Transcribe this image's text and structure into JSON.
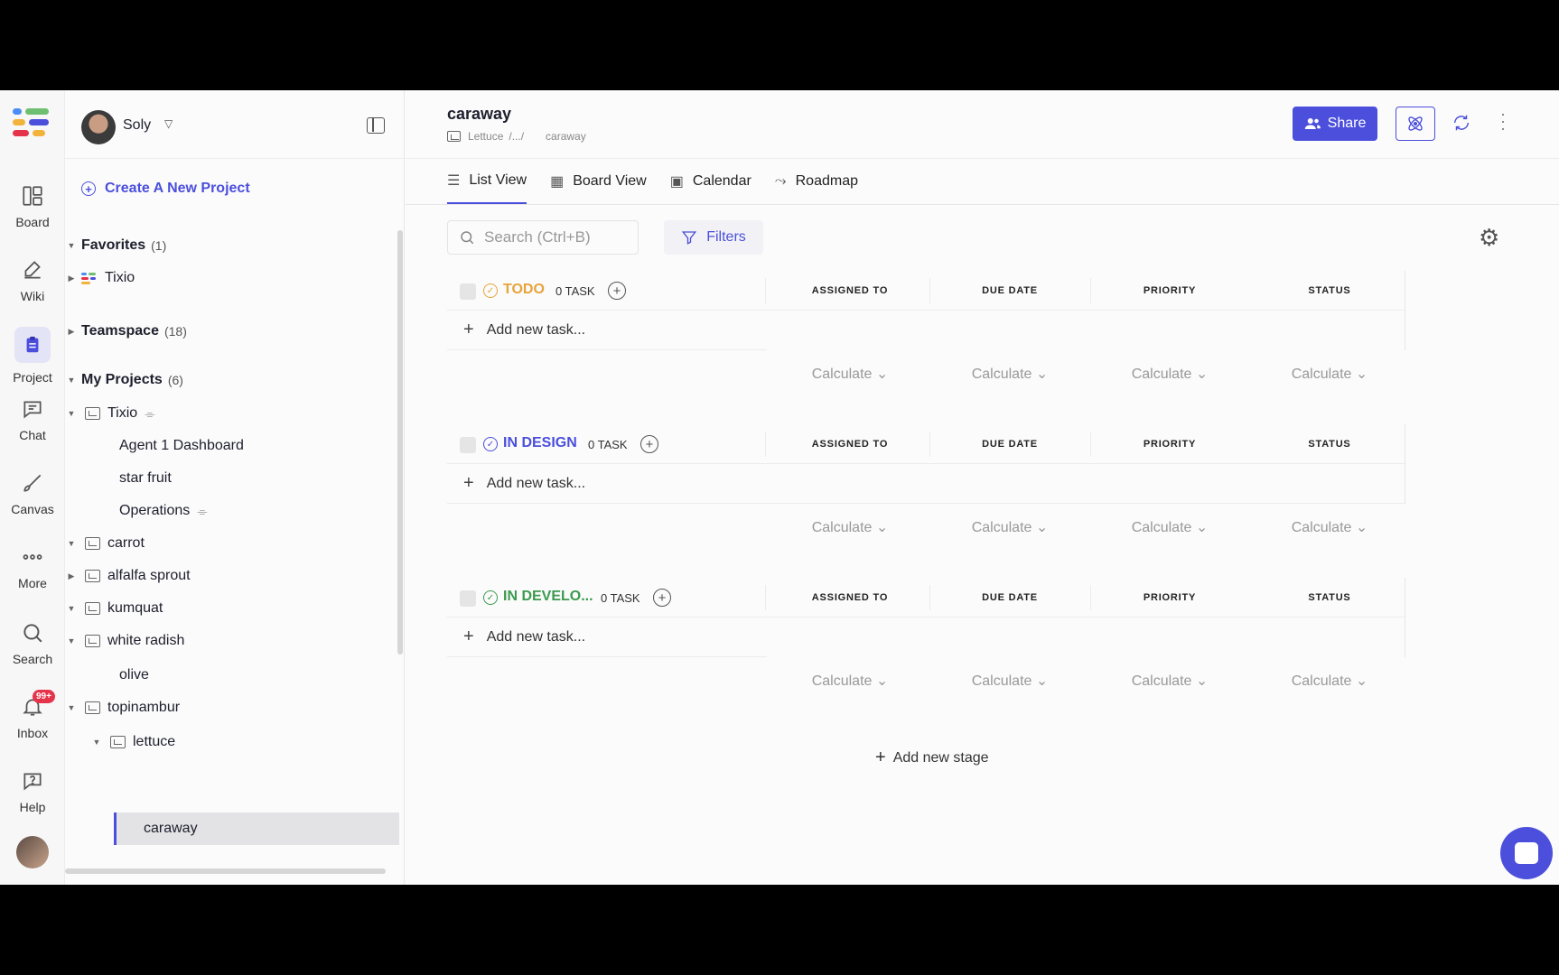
{
  "rail": {
    "items": [
      {
        "label": "Board",
        "icon": "board-icon"
      },
      {
        "label": "Wiki",
        "icon": "wiki-icon"
      },
      {
        "label": "Project",
        "icon": "project-icon"
      },
      {
        "label": "Chat",
        "icon": "chat-icon"
      },
      {
        "label": "Canvas",
        "icon": "canvas-icon"
      },
      {
        "label": "More",
        "icon": "more-icon"
      },
      {
        "label": "Search",
        "icon": "search-icon"
      },
      {
        "label": "Inbox",
        "icon": "bell-icon"
      },
      {
        "label": "Help",
        "icon": "help-icon"
      }
    ],
    "inbox_badge": "99+"
  },
  "sidebar": {
    "user_name": "Soly",
    "create_project": "Create A New Project",
    "favorites": {
      "label": "Favorites",
      "count": "(1)",
      "items": [
        "Tixio"
      ]
    },
    "teamspace": {
      "label": "Teamspace",
      "count": "(18)"
    },
    "my_projects": {
      "label": "My Projects",
      "count": "(6)"
    },
    "tree": {
      "tixio": "Tixio",
      "agent_dashboard": "Agent 1 Dashboard",
      "star_fruit": "star fruit",
      "operations": "Operations",
      "carrot": "carrot",
      "alfalfa": "alfalfa sprout",
      "kumquat": "kumquat",
      "white_radish": "white radish",
      "olive": "olive",
      "topinambur": "topinambur",
      "lettuce": "lettuce",
      "caraway": "caraway"
    }
  },
  "header": {
    "title": "caraway",
    "breadcrumb_parent": "Lettuce",
    "breadcrumb_sep": "/.../",
    "breadcrumb_current": "caraway",
    "share_label": "Share"
  },
  "tabs": [
    "List View",
    "Board View",
    "Calendar",
    "Roadmap"
  ],
  "toolbar": {
    "search_placeholder": "Search (Ctrl+B)",
    "filters_label": "Filters"
  },
  "columns": [
    "ASSIGNED TO",
    "DUE DATE",
    "PRIORITY",
    "STATUS"
  ],
  "calculate_label": "Calculate",
  "add_task_label": "Add new task...",
  "stages": [
    {
      "name": "TODO",
      "count": "0 TASK",
      "color": "#e8a33a"
    },
    {
      "name": "IN DESIGN",
      "count": "0 TASK",
      "color": "#4b4fdc"
    },
    {
      "name": "IN DEVELO...",
      "count": "0 TASK",
      "color": "#3b9a4f"
    }
  ],
  "add_stage_label": "Add new stage",
  "colors": {
    "accent": "#4b4fdc"
  }
}
